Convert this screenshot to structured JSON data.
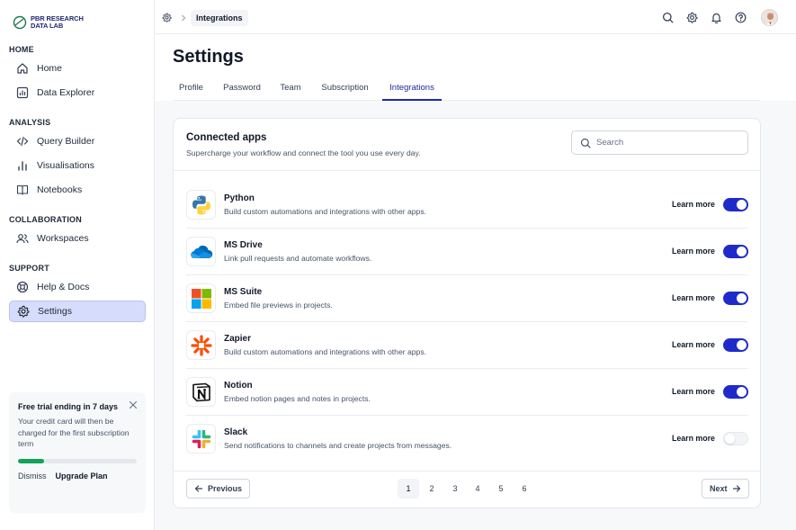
{
  "brand": {
    "line1": "PBR RESEARCH",
    "line2": "DATA LAB"
  },
  "sidebar": {
    "sections": [
      {
        "title": "HOME",
        "items": [
          {
            "label": "Home",
            "icon": "home-icon"
          },
          {
            "label": "Data Explorer",
            "icon": "chart-box-icon"
          }
        ]
      },
      {
        "title": "ANALYSIS",
        "items": [
          {
            "label": "Query Builder",
            "icon": "code-icon"
          },
          {
            "label": "Visualisations",
            "icon": "bar-chart-icon"
          },
          {
            "label": "Notebooks",
            "icon": "book-icon"
          }
        ]
      },
      {
        "title": "COLLABORATION",
        "items": [
          {
            "label": "Workspaces",
            "icon": "users-icon"
          }
        ]
      },
      {
        "title": "SUPPORT",
        "items": [
          {
            "label": "Help & Docs",
            "icon": "lifebuoy-icon"
          },
          {
            "label": "Settings",
            "icon": "gear-icon",
            "active": true
          }
        ]
      }
    ],
    "trial": {
      "title": "Free trial ending in 7 days",
      "body": "Your credit card will then be charged for the first subscription term",
      "progress": 0.22,
      "dismiss": "Dismiss",
      "upgrade": "Upgrade Plan"
    }
  },
  "breadcrumb": {
    "current": "Integrations"
  },
  "page": {
    "title": "Settings"
  },
  "tabs": [
    {
      "label": "Profile"
    },
    {
      "label": "Password"
    },
    {
      "label": "Team"
    },
    {
      "label": "Subscription"
    },
    {
      "label": "Integrations",
      "active": true
    }
  ],
  "card": {
    "title": "Connected apps",
    "subtitle": "Supercharge your workflow and connect the tool you use every day.",
    "search_placeholder": "Search"
  },
  "apps": [
    {
      "name": "Python",
      "desc": "Build custom automations and integrations with other apps.",
      "learn": "Learn more",
      "enabled": true
    },
    {
      "name": "MS Drive",
      "desc": "Link pull requests and automate workflows.",
      "learn": "Learn more",
      "enabled": true
    },
    {
      "name": "MS Suite",
      "desc": "Embed file previews in projects.",
      "learn": "Learn more",
      "enabled": true
    },
    {
      "name": "Zapier",
      "desc": "Build custom automations and integrations with other apps.",
      "learn": "Learn more",
      "enabled": true
    },
    {
      "name": "Notion",
      "desc": "Embed notion pages and notes in projects.",
      "learn": "Learn more",
      "enabled": true
    },
    {
      "name": "Slack",
      "desc": "Send notifications to channels and create projects from messages.",
      "learn": "Learn more",
      "enabled": false
    }
  ],
  "pagination": {
    "previous": "Previous",
    "next": "Next",
    "pages": [
      "1",
      "2",
      "3",
      "4",
      "5",
      "6"
    ],
    "current": "1"
  },
  "colors": {
    "accent": "#1f2bc9",
    "active_nav": "#d6dcfb",
    "progress": "#12a35a"
  }
}
